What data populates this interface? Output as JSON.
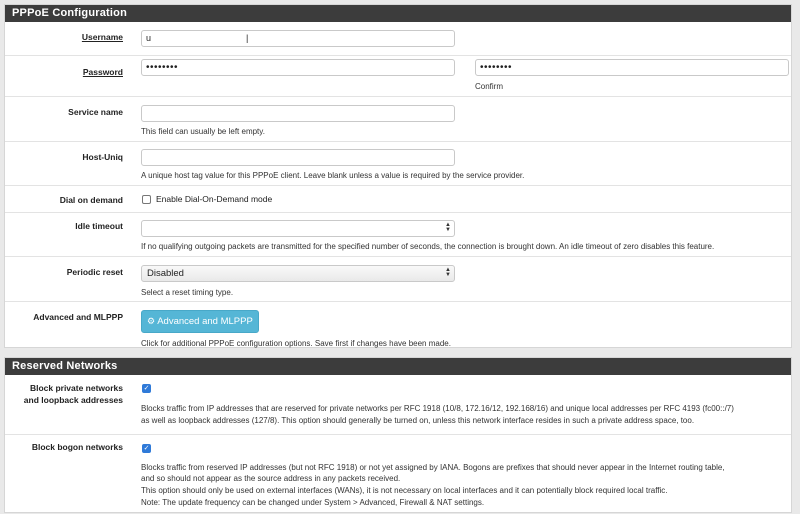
{
  "pppoe": {
    "title": "PPPoE Configuration",
    "username": {
      "label": "Username",
      "value": "u",
      "cursor": "|"
    },
    "password": {
      "label": "Password",
      "value": "••••••••",
      "confirm_value": "••••••••",
      "confirm_label": "Confirm"
    },
    "service_name": {
      "label": "Service name",
      "value": "",
      "help": "This field can usually be left empty."
    },
    "host_uniq": {
      "label": "Host-Uniq",
      "value": "",
      "help": "A unique host tag value for this PPPoE client. Leave blank unless a value is required by the service provider."
    },
    "dial_on_demand": {
      "label": "Dial on demand",
      "checkbox_label": "Enable Dial-On-Demand mode",
      "checked": false
    },
    "idle_timeout": {
      "label": "Idle timeout",
      "value": "",
      "help": "If no qualifying outgoing packets are transmitted for the specified number of seconds, the connection is brought down. An idle timeout of zero disables this feature."
    },
    "periodic_reset": {
      "label": "Periodic reset",
      "selected": "Disabled",
      "help": "Select a reset timing type."
    },
    "advanced": {
      "label": "Advanced and MLPPP",
      "button": "Advanced and MLPPP",
      "help": "Click for additional PPPoE configuration options. Save first if changes have been made."
    }
  },
  "reserved": {
    "title": "Reserved Networks",
    "block_private": {
      "label_line1": "Block private networks",
      "label_line2": "and loopback addresses",
      "checked": true,
      "help_line1": "Blocks traffic from IP addresses that are reserved for private networks per RFC 1918 (10/8, 172.16/12, 192.168/16) and unique local addresses per RFC 4193 (fc00::/7)",
      "help_line2": "as well as loopback addresses (127/8). This option should generally be turned on, unless this network interface resides in such a private address space, too."
    },
    "block_bogon": {
      "label": "Block bogon networks",
      "checked": true,
      "help_line1": "Blocks traffic from reserved IP addresses (but not RFC 1918) or not yet assigned by IANA. Bogons are prefixes that should never appear in the Internet routing table,",
      "help_line2": "and so should not appear as the source address in any packets received.",
      "help_line3": "This option should only be used on external interfaces (WANs), it is not necessary on local interfaces and it can potentially block required local traffic.",
      "help_line4": "Note: The update frequency can be changed under System > Advanced, Firewall & NAT settings."
    }
  }
}
